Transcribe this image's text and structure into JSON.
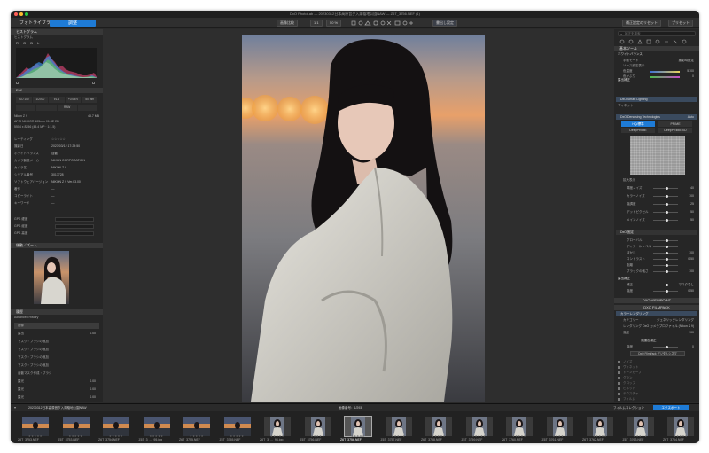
{
  "window": {
    "title": "DxO PhotoLab — 20230312日本高原音夕入湖稲地公園NAW — Z6T_3756.NEF (1)"
  },
  "toolbar": {
    "tab_library": "フォトライブラリ",
    "tab_customize": "調整",
    "btn_compare": "画像比較",
    "btn_zoom": "1:1",
    "zoom_value": "50 %",
    "btn_export_hint": "書出し設定",
    "btn_reset": "補正設定のリセット",
    "btn_preset": "プリセット"
  },
  "left": {
    "histogram": {
      "header": "ヒストグラム",
      "sub": "ヒストグラム",
      "channels": [
        "R",
        "G",
        "B",
        "L"
      ]
    },
    "exif": {
      "header": "Exif",
      "cells_row1": [
        "ISO 100",
        "1/2000",
        "f/1.4",
        "+0.0 EV",
        "50 mm"
      ],
      "raw_label": "RAW",
      "camera_line": "Nikon Z 9",
      "file_size": "48.7 MB",
      "lens_line": "AF-S NIKKOR 105mm f/1.4E ED",
      "dims": "5504 x 8256 (45.4 MP · 1:1.5)"
    },
    "meta_rows": [
      {
        "k": "レーティング",
        "v": "☆☆☆☆☆"
      },
      {
        "k": "撮影日",
        "v": "2023/03/12 17:29:50"
      },
      {
        "k": "ホワイトバランス",
        "v": "自動"
      },
      {
        "k": "カメラ製造メーカー",
        "v": "NIKON CORPORATION"
      },
      {
        "k": "カメラ名",
        "v": "NIKON Z 9"
      },
      {
        "k": "シリアル番号",
        "v": "3017728"
      },
      {
        "k": "ソフトウェアバージョン",
        "v": "NIKON Z 9 Ver.03.00"
      },
      {
        "k": "著作",
        "v": "—"
      },
      {
        "k": "コピーライト",
        "v": "—"
      },
      {
        "k": "キーワード",
        "v": "—"
      }
    ],
    "gps_rows": [
      "GPS 緯度",
      "GPS 経度",
      "GPS 高度"
    ],
    "move_header": "移動／ズーム",
    "history": {
      "header": "履歴",
      "sub": "Advanced History",
      "items": [
        {
          "label": "画像",
          "val": ""
        },
        {
          "label": "露出",
          "val": "0.00"
        },
        {
          "label": "マスク・ブラシの追加",
          "val": ""
        },
        {
          "label": "マスク・ブラシの追加",
          "val": ""
        },
        {
          "label": "マスク・ブラシの追加",
          "val": ""
        },
        {
          "label": "マスク・ブラシの追加",
          "val": ""
        },
        {
          "label": "自動マスク作成・ブラシ",
          "val": ""
        },
        {
          "label": "露光",
          "val": "0.00"
        },
        {
          "label": "露光",
          "val": "0.00"
        },
        {
          "label": "露光",
          "val": "0.00"
        }
      ]
    }
  },
  "right": {
    "search_placeholder": "補正を検索",
    "essential_header": "基本ツール",
    "wb_header": "ホワイトバランス",
    "wb_rows": [
      {
        "k": "手動モード",
        "v": "撮影時設定"
      },
      {
        "k": "ソース設定表示",
        "v": ""
      },
      {
        "k": "色温度",
        "v": "5100"
      },
      {
        "k": "色かぶり",
        "v": "0"
      }
    ],
    "exposure_header": "露出補正",
    "smart_lighting": "DxO Smart Lighting",
    "color_label": "ヴィネット",
    "denoise_header": "DxO Denoising Technologies",
    "denoise_auto": "Auto",
    "denoise_modes": [
      "HQ/標準",
      "PRIME",
      "DeepPRIME",
      "DeepPRIME XD"
    ],
    "denoise_preview_label": "拡大表示",
    "denoise_rows": [
      {
        "k": "輝度ノイズ",
        "v": "40"
      },
      {
        "k": "カラーノイズ",
        "v": "100"
      },
      {
        "k": "強調度",
        "v": "25"
      },
      {
        "k": "デッドピクセル",
        "v": "50"
      },
      {
        "k": "メインノイズ",
        "v": "50"
      }
    ],
    "sharpen_header": "DxO 固定",
    "sharpen_rows": [
      {
        "k": "グローバル",
        "v": ""
      },
      {
        "k": "ディテールレベル",
        "v": ""
      },
      {
        "k": "ぼかし",
        "v": "100"
      },
      {
        "k": "コントラスト",
        "v": "0.50"
      },
      {
        "k": "距離",
        "v": ""
      },
      {
        "k": "ブラックの強さ",
        "v": "100"
      }
    ],
    "style_header": "露出補正",
    "style_rows": [
      {
        "k": "補正",
        "v": "マスクなし"
      },
      {
        "k": "強度",
        "v": "0.50"
      }
    ],
    "viewpoint_header": "DXO VIEWPOINT",
    "filmpack_header": "DXO FILMPACK",
    "color_render_header": "カラーレンダリング",
    "color_render_rows": [
      {
        "k": "カテゴリー",
        "v": "ジェネリックレンダリング"
      },
      {
        "k": "レンダリング",
        "v": "DxO カメラプロファイル (Nikon Z 9)"
      },
      {
        "k": "強度",
        "v": "100"
      }
    ],
    "protect_header": "保護色補正",
    "protect_rows": [
      {
        "k": "強度",
        "v": "0"
      }
    ],
    "filmpack_btn": "DxO FilmPack デジタルシネマ",
    "bottom_list": [
      "ノイズ",
      "ヴィネット",
      "トーンカーブ",
      "グラン",
      "クロップ",
      "ビネット",
      "テクスチャ",
      "フィルム"
    ]
  },
  "filmstrip": {
    "folder": "20230312日本高原音夕入湖稲地公園NAW",
    "center_label": "画像番号：1/293",
    "collection": "フィルムコレクション",
    "export_btn": "エクスポート",
    "thumbs": [
      {
        "name": "Z6T_3753.NEF",
        "kind": "dusk"
      },
      {
        "name": "Z6T_3753.NEF",
        "kind": "dusk"
      },
      {
        "name": "Z6T_3754.NEF",
        "kind": "dusk"
      },
      {
        "name": "Z6T_3_..._95.jpg",
        "kind": "dusk"
      },
      {
        "name": "Z6T_3755.NEF",
        "kind": "dusk"
      },
      {
        "name": "Z6T_3755.NEF",
        "kind": "dusk"
      },
      {
        "name": "Z6T_3_..._96.jpg",
        "kind": "portrait"
      },
      {
        "name": "Z6T_3756.NEF",
        "kind": "portrait"
      },
      {
        "name": "Z6T_3756.NEF",
        "kind": "selected"
      },
      {
        "name": "Z6T_3757.NEF",
        "kind": "portrait"
      },
      {
        "name": "Z6T_3758.NEF",
        "kind": "portrait"
      },
      {
        "name": "Z6T_3759.NEF",
        "kind": "portrait"
      },
      {
        "name": "Z6T_3760.NEF",
        "kind": "portrait"
      },
      {
        "name": "Z6T_3761.NEF",
        "kind": "portrait"
      },
      {
        "name": "Z6T_3762.NEF",
        "kind": "portrait"
      },
      {
        "name": "Z6T_3763.NEF",
        "kind": "portrait"
      },
      {
        "name": "Z6T_3764.NEF",
        "kind": "portrait"
      }
    ]
  },
  "colors": {
    "accent": "#1e7bd6",
    "panel": "#262626",
    "header": "#383838"
  }
}
